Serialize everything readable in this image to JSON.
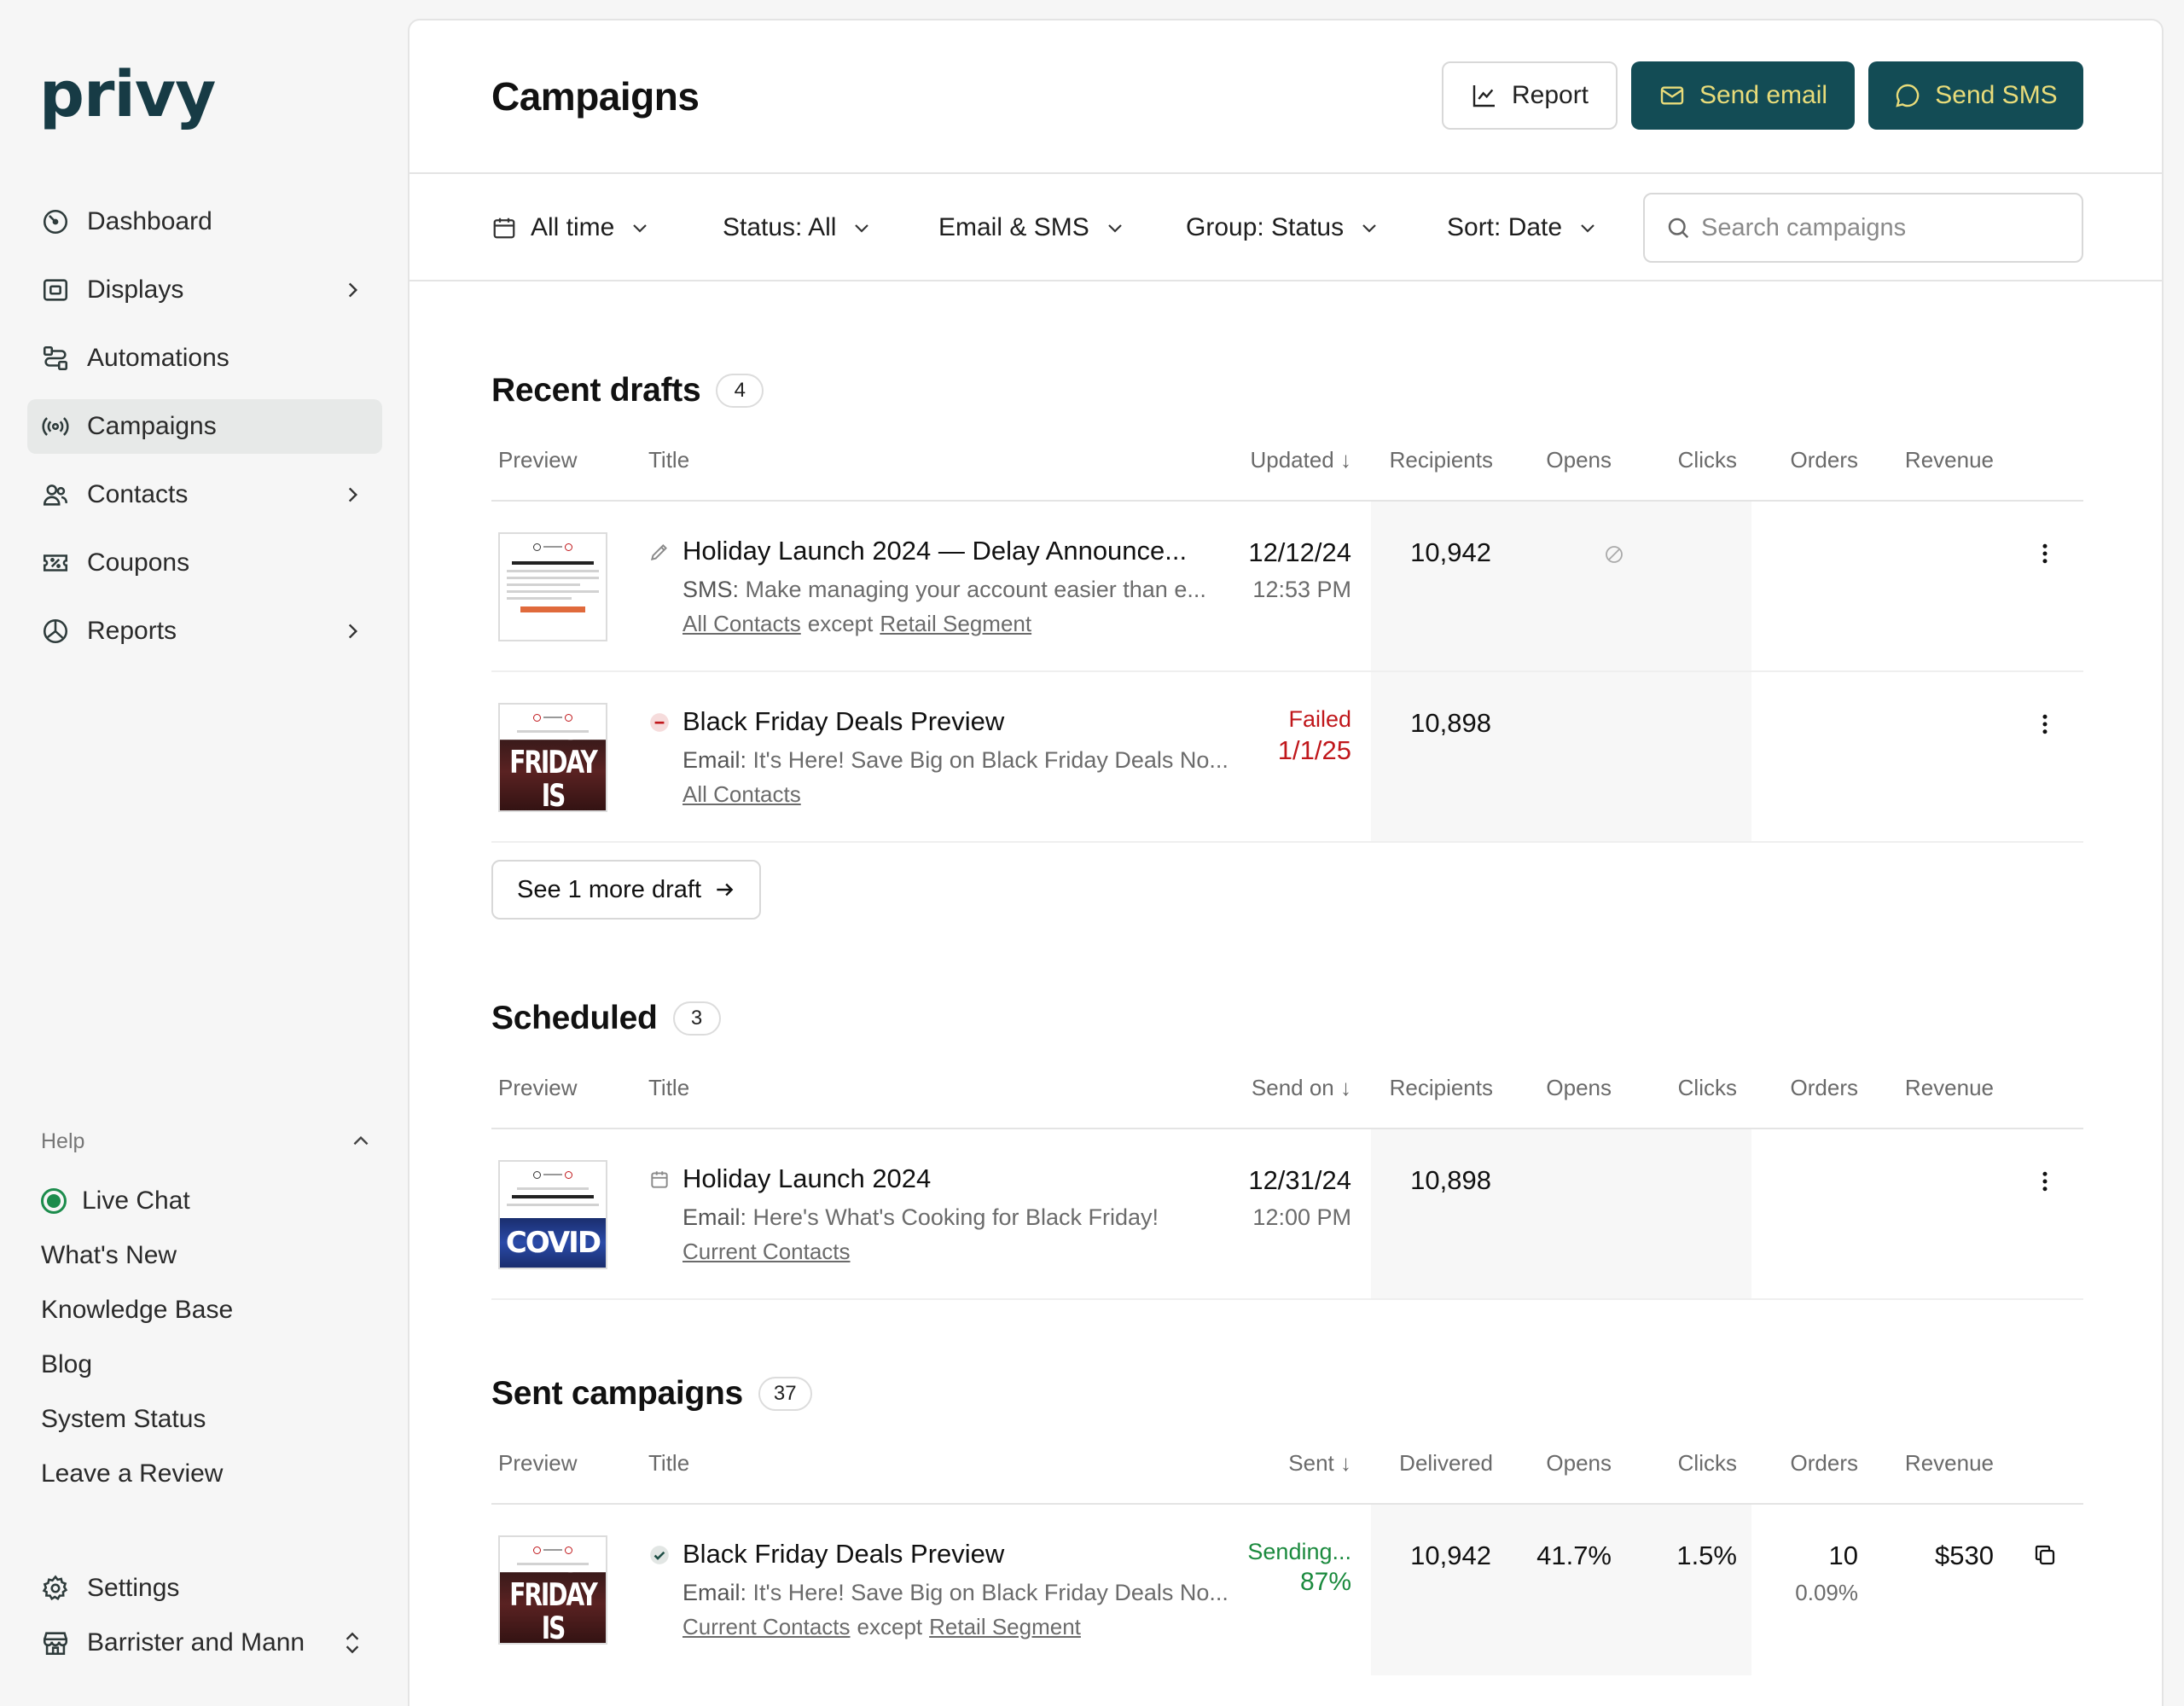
{
  "brand": {
    "logo": "privy"
  },
  "sidebar": {
    "items": [
      {
        "label": "Dashboard",
        "icon": "dashboard-icon",
        "has_chevron": false
      },
      {
        "label": "Displays",
        "icon": "displays-icon",
        "has_chevron": true
      },
      {
        "label": "Automations",
        "icon": "automations-icon",
        "has_chevron": false
      },
      {
        "label": "Campaigns",
        "icon": "campaigns-icon",
        "has_chevron": false,
        "active": true
      },
      {
        "label": "Contacts",
        "icon": "contacts-icon",
        "has_chevron": true
      },
      {
        "label": "Coupons",
        "icon": "coupons-icon",
        "has_chevron": false
      },
      {
        "label": "Reports",
        "icon": "reports-icon",
        "has_chevron": true
      }
    ],
    "help": {
      "label": "Help",
      "items": [
        "Live Chat",
        "What's New",
        "Knowledge Base",
        "Blog",
        "System Status",
        "Leave a Review"
      ]
    },
    "settings_label": "Settings",
    "account_label": "Barrister and Mann"
  },
  "header": {
    "title": "Campaigns",
    "report_label": "Report",
    "send_email_label": "Send email",
    "send_sms_label": "Send SMS"
  },
  "filters": {
    "time": "All time",
    "status": "Status: All",
    "channel": "Email & SMS",
    "group": "Group: Status",
    "sort": "Sort: Date",
    "search_placeholder": "Search campaigns"
  },
  "drafts": {
    "title": "Recent drafts",
    "count": "4",
    "columns": [
      "Preview",
      "Title",
      "Updated ↓",
      "Recipients",
      "Opens",
      "Clicks",
      "Orders",
      "Revenue"
    ],
    "rows": [
      {
        "title": "Holiday Launch 2024 — Delay Announce...",
        "channel": "SMS:",
        "subject": "Make managing your account easier than e...",
        "audience": "All Contacts",
        "except_word": "except",
        "excluded": "Retail Segment",
        "date": "12/12/24",
        "time": "12:53 PM",
        "recipients": "10,942",
        "thumb_head": "THE Q4 RELEASE SCHEDULE IS HERE!"
      },
      {
        "title": "Black Friday Deals Preview",
        "channel": "Email:",
        "subject": "It's Here! Save Big on Black Friday Deals No...",
        "audience": "All Contacts",
        "status": "Failed",
        "date": "1/1/25",
        "recipients": "10,898",
        "thumb_text": "BLACK FRIDAY IS COMING"
      }
    ],
    "more_label": "See 1 more draft"
  },
  "scheduled": {
    "title": "Scheduled",
    "count": "3",
    "columns": [
      "Preview",
      "Title",
      "Send on ↓",
      "Recipients",
      "Opens",
      "Clicks",
      "Orders",
      "Revenue"
    ],
    "rows": [
      {
        "title": "Holiday Launch 2024",
        "channel": "Email:",
        "subject": "Here's What's Cooking for Black Friday!",
        "audience": "Current Contacts",
        "date": "12/31/24",
        "time": "12:00 PM",
        "recipients": "10,898",
        "thumb_head": "WE HAVE TO MAKE A SLIGHT CHANGE",
        "thumb_text": "COVID"
      }
    ]
  },
  "sent": {
    "title": "Sent campaigns",
    "count": "37",
    "columns": [
      "Preview",
      "Title",
      "Sent ↓",
      "Delivered",
      "Opens",
      "Clicks",
      "Orders",
      "Revenue"
    ],
    "rows": [
      {
        "title": "Black Friday Deals Preview",
        "channel": "Email:",
        "subject": "It's Here! Save Big on Black Friday Deals No...",
        "audience": "Current Contacts",
        "except_word": "except",
        "excluded": "Retail Segment",
        "status": "Sending...",
        "progress": "87%",
        "delivered": "10,942",
        "opens": "41.7%",
        "clicks": "1.5%",
        "orders": "10",
        "orders_rate": "0.09%",
        "revenue": "$530",
        "thumb_text": "BLACK FRIDAY IS COMING"
      }
    ]
  },
  "colors": {
    "brand": "#134c55",
    "brand_text": "#e9dc7a",
    "failed": "#c0171b",
    "sending": "#1b8a3e"
  }
}
